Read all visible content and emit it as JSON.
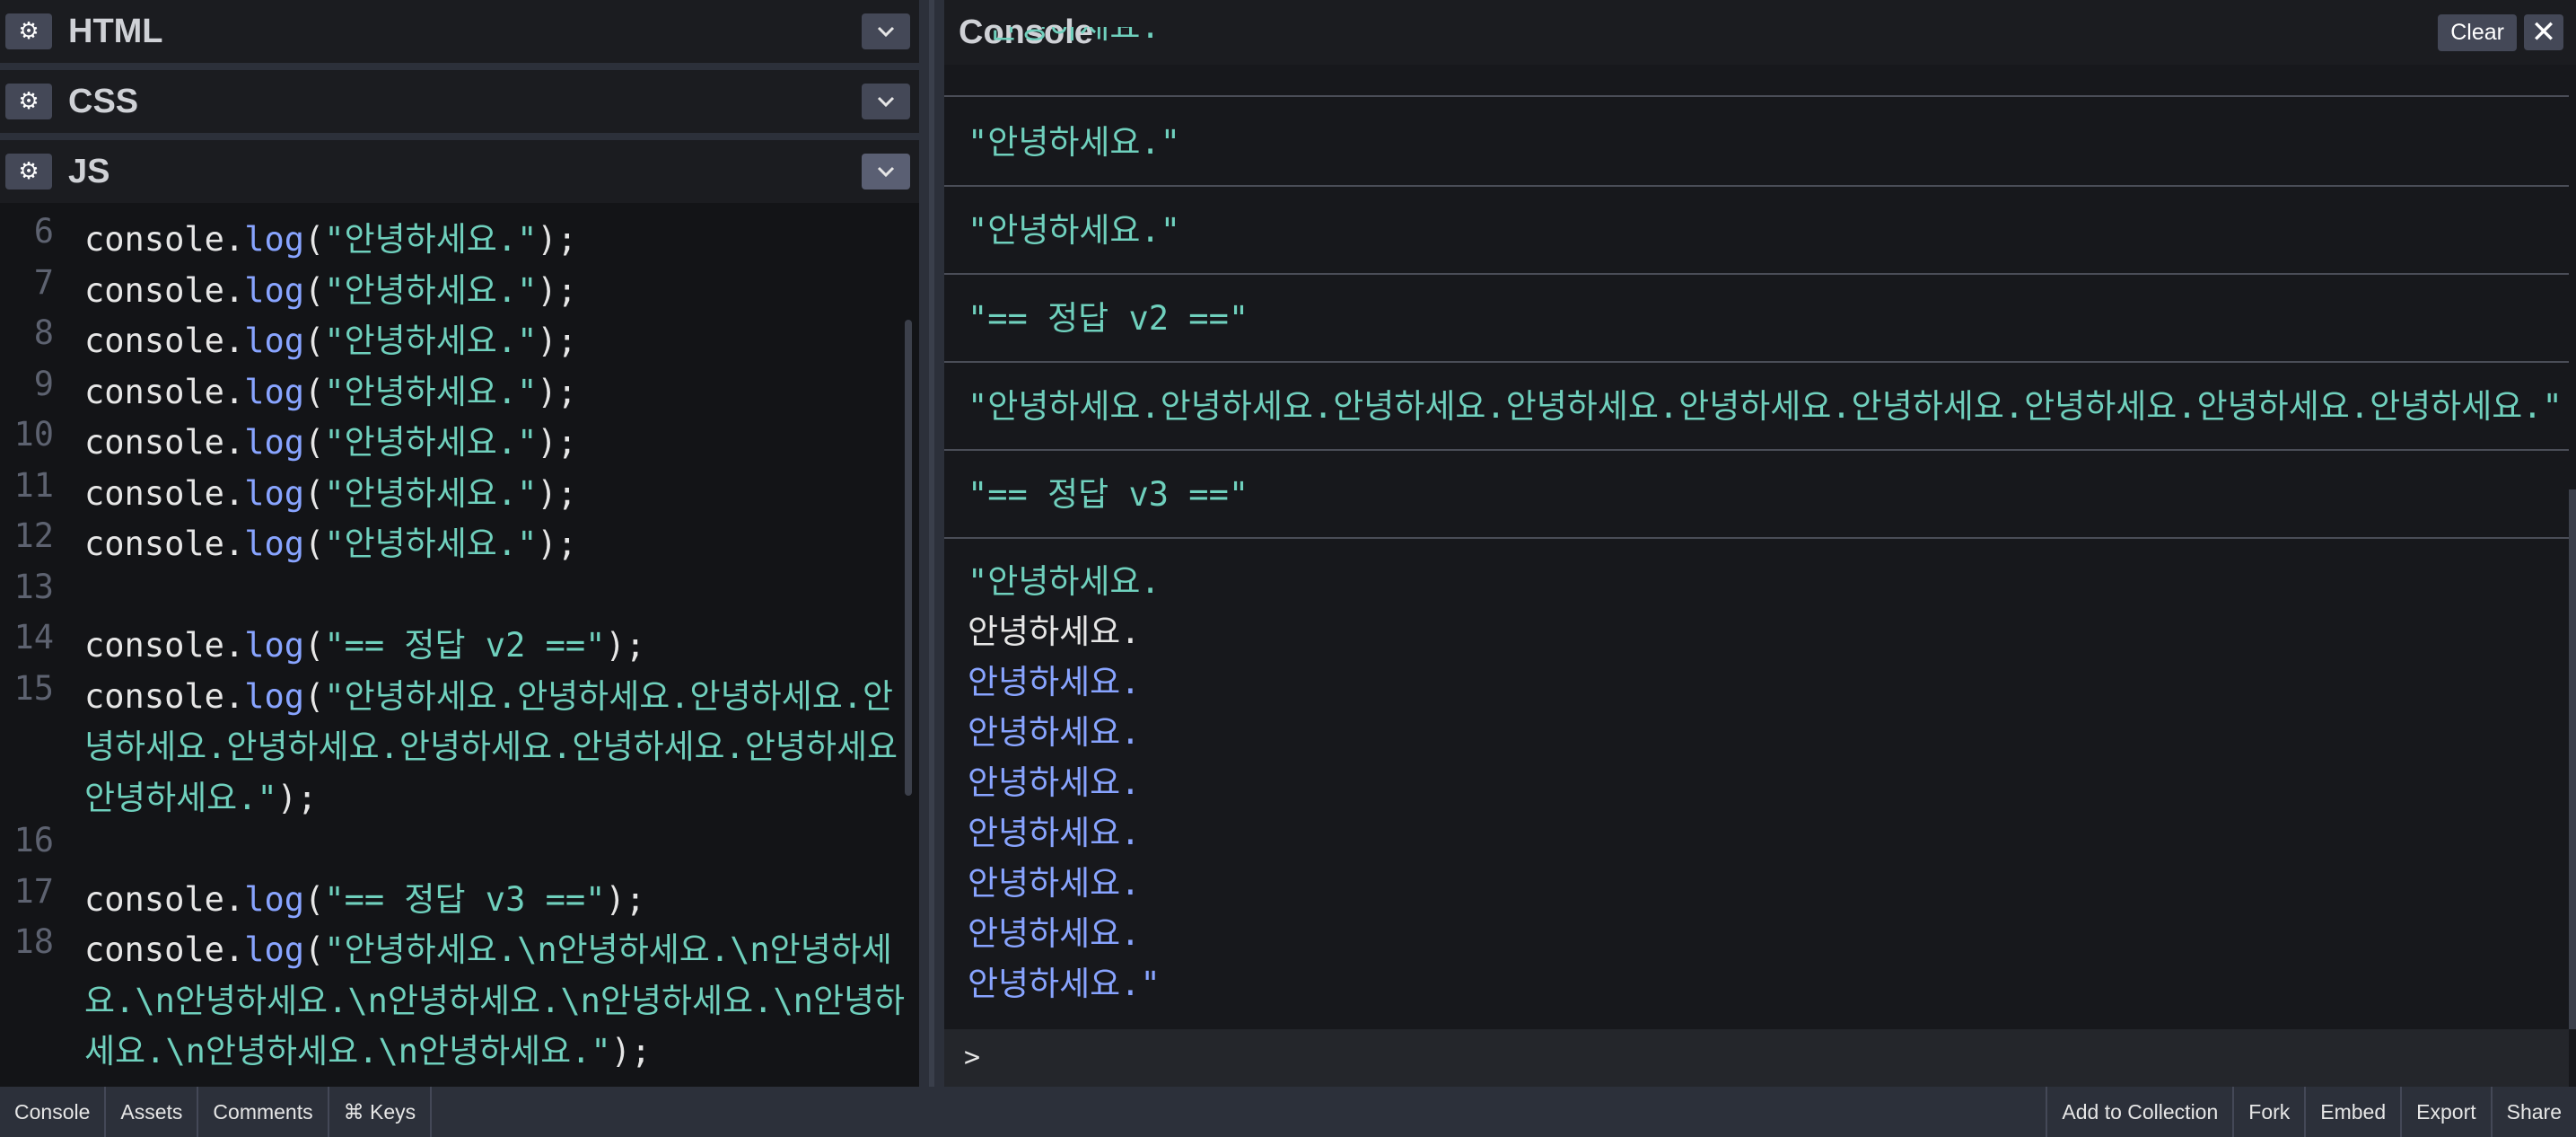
{
  "panels": {
    "html": {
      "title": "HTML"
    },
    "css": {
      "title": "CSS"
    },
    "js": {
      "title": "JS"
    }
  },
  "editor": {
    "lines": [
      {
        "num": "6",
        "str": "\"안녕하세요.\""
      },
      {
        "num": "7",
        "str": "\"안녕하세요.\""
      },
      {
        "num": "8",
        "str": "\"안녕하세요.\""
      },
      {
        "num": "9",
        "str": "\"안녕하세요.\""
      },
      {
        "num": "10",
        "str": "\"안녕하세요.\""
      },
      {
        "num": "11",
        "str": "\"안녕하세요.\""
      },
      {
        "num": "12",
        "str": "\"안녕하세요.\""
      },
      {
        "num": "13",
        "str": ""
      },
      {
        "num": "14",
        "str": "\"== 정답 v2 ==\""
      },
      {
        "num": "15",
        "str": "\"안녕하세요.안녕하세요.안녕하세요.안",
        "cont": [
          "녕하세요.안녕하세요.안녕하세요.안녕하세요.안녕하세요.",
          "안녕하세요.\""
        ]
      },
      {
        "num": "16",
        "str": ""
      },
      {
        "num": "17",
        "str": "\"== 정답 v3 ==\""
      },
      {
        "num": "18",
        "str": "\"안녕하세요.\\n안녕하세요.\\n안녕하세",
        "cont": [
          "요.\\n안녕하세요.\\n안녕하세요.\\n안녕하세요.\\n안녕하",
          "세요.\\n안녕하세요.\\n안녕하세요.\""
        ]
      }
    ],
    "obj": "console",
    "dot": ".",
    "fn": "log",
    "open": "(",
    "close": ");"
  },
  "console": {
    "title": "Console",
    "clear_label": "Clear",
    "close_label": "✕",
    "prompt": ">",
    "logs": [
      "\"안녕하세요.\"",
      "\"안녕하세요.\"",
      "\"안녕하세요.\"",
      "\"== 정답 v2 ==\"",
      "\"안녕하세요.안녕하세요.안녕하세요.안녕하세요.안녕하세요.안녕하세요.안녕하세요.안녕하세요.안녕하세요.\"",
      "\"== 정답 v3 ==\""
    ],
    "multiline": [
      "\"안녕하세요.",
      "안녕하세요.",
      "안녕하세요.",
      "안녕하세요.",
      "안녕하세요.",
      "안녕하세요.",
      "안녕하세요.",
      "안녕하세요.",
      "안녕하세요.\""
    ]
  },
  "footer": {
    "left": [
      "Console",
      "Assets",
      "Comments",
      "⌘ Keys"
    ],
    "right": [
      "Add to Collection",
      "Fork",
      "Embed",
      "Export",
      "Share"
    ]
  }
}
